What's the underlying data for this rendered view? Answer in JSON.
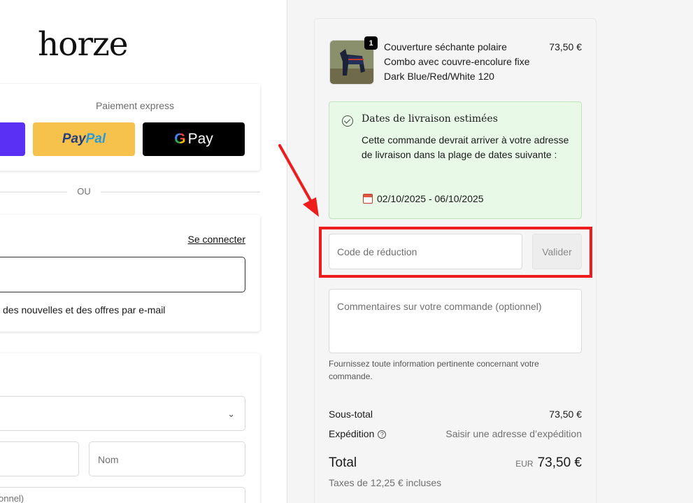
{
  "brand": {
    "logo_text": "horze"
  },
  "express": {
    "title": "Paiement express",
    "paypal_part1": "Pay",
    "paypal_part2": "Pal",
    "gpay_g": "G",
    "gpay_label": "Pay"
  },
  "divider": {
    "label": "OU"
  },
  "contact": {
    "login_link": "Se connecter",
    "newsletter_text": "des nouvelles et des offres par e-mail"
  },
  "delivery": {
    "last_name_placeholder": "Nom",
    "company_placeholder": "onnel)"
  },
  "order": {
    "product": {
      "quantity": "1",
      "name": "Couverture séchante polaire Combo avec couvre-encolure fixe Dark Blue/Red/White 120",
      "price": "73,50 €"
    },
    "estimated_delivery": {
      "title": "Dates de livraison estimées",
      "text": "Cette commande devrait arriver à votre adresse de livraison dans la plage de dates suivante :",
      "dates": "02/10/2025 - 06/10/2025"
    },
    "discount": {
      "placeholder": "Code de réduction",
      "button_label": "Valider"
    },
    "comments": {
      "placeholder": "Commentaires sur votre commande (optionnel)",
      "help": "Fournissez toute information pertinente concernant votre commande."
    },
    "subtotal": {
      "label": "Sous-total",
      "value": "73,50 €"
    },
    "shipping": {
      "label": "Expédition",
      "help_glyph": "?",
      "value": "Saisir une adresse d’expédition"
    },
    "total": {
      "label": "Total",
      "currency": "EUR",
      "value": "73,50 €"
    },
    "taxes": "Taxes de 12,25 € incluses"
  },
  "colors": {
    "highlight_red": "#ee1c1c",
    "delivery_box_bg": "#e9f9e8",
    "shop_pay_purple": "#5a31f4",
    "paypal_yellow": "#f7c24b"
  }
}
